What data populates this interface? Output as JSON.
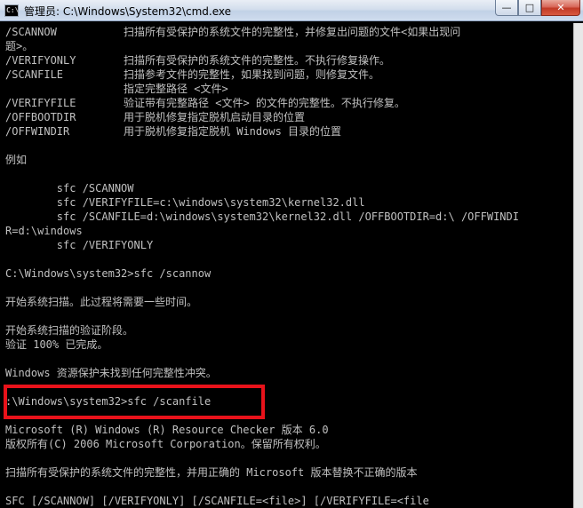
{
  "window": {
    "title": "管理员: C:\\Windows\\System32\\cmd.exe",
    "icon": "cmd-icon",
    "controls": {
      "minimize": "—",
      "maximize": "□",
      "close": "✕"
    }
  },
  "console": {
    "lines": [
      {
        "c1": "/SCANNOW",
        "c2": "扫描所有受保护的系统文件的完整性，并修复出问题的文件<如果出现问"
      },
      {
        "c1": "题>。",
        "c2": ""
      },
      {
        "c1": "/VERIFYONLY",
        "c2": "扫描所有受保护的系统文件的完整性。不执行修复操作。"
      },
      {
        "c1": "/SCANFILE",
        "c2": "扫描参考文件的完整性，如果找到问题，则修复文件。"
      },
      {
        "c1": "",
        "c2": "指定完整路径 <文件>"
      },
      {
        "c1": "/VERIFYFILE",
        "c2": "验证带有完整路径 <文件> 的文件的完整性。不执行修复。"
      },
      {
        "c1": "/OFFBOOTDIR",
        "c2": "用于脱机修复指定脱机启动目录的位置"
      },
      {
        "c1": "/OFFWINDIR",
        "c2": "用于脱机修复指定脱机 Windows 目录的位置"
      },
      {
        "c1": "",
        "c2": ""
      },
      {
        "c1": "例如",
        "c2": ""
      },
      {
        "c1": "",
        "c2": ""
      },
      {
        "c1": "        sfc /SCANNOW",
        "c2": ""
      },
      {
        "c1": "        sfc /VERIFYFILE=c:\\windows\\system32\\kernel32.dll",
        "c2": ""
      },
      {
        "c1": "        sfc /SCANFILE=d:\\windows\\system32\\kernel32.dll /OFFBOOTDIR=d:\\ /OFFWINDI",
        "c2": ""
      },
      {
        "c1": "R=d:\\windows",
        "c2": ""
      },
      {
        "c1": "        sfc /VERIFYONLY",
        "c2": ""
      },
      {
        "c1": "",
        "c2": ""
      },
      {
        "c1": "C:\\Windows\\system32>sfc /scannow",
        "c2": ""
      },
      {
        "c1": "",
        "c2": ""
      },
      {
        "c1": "开始系统扫描。此过程将需要一些时间。",
        "c2": ""
      },
      {
        "c1": "",
        "c2": ""
      },
      {
        "c1": "开始系统扫描的验证阶段。",
        "c2": ""
      },
      {
        "c1": "验证 100% 已完成。",
        "c2": ""
      },
      {
        "c1": "",
        "c2": ""
      },
      {
        "c1": "Windows 资源保护未找到任何完整性冲突。",
        "c2": ""
      },
      {
        "c1": "",
        "c2": ""
      },
      {
        "c1": ":\\Windows\\system32>sfc /scanfile",
        "c2": ""
      },
      {
        "c1": "",
        "c2": ""
      },
      {
        "c1": "Microsoft (R) Windows (R) Resource Checker 版本 6.0",
        "c2": ""
      },
      {
        "c1": "版权所有(C) 2006 Microsoft Corporation。保留所有权利。",
        "c2": ""
      },
      {
        "c1": "",
        "c2": ""
      },
      {
        "c1": "扫描所有受保护的系统文件的完整性，并用正确的 Microsoft 版本替换不正确的版本",
        "c2": ""
      },
      {
        "c1": "",
        "c2": ""
      },
      {
        "c1": "SFC [/SCANNOW] [/VERIFYONLY] [/SCANFILE=<file>] [/VERIFYFILE=<file",
        "c2": ""
      }
    ]
  },
  "highlight": {
    "color": "#e8121a"
  },
  "colors": {
    "console_bg": "#000000",
    "console_fg": "#c0c0c0"
  }
}
